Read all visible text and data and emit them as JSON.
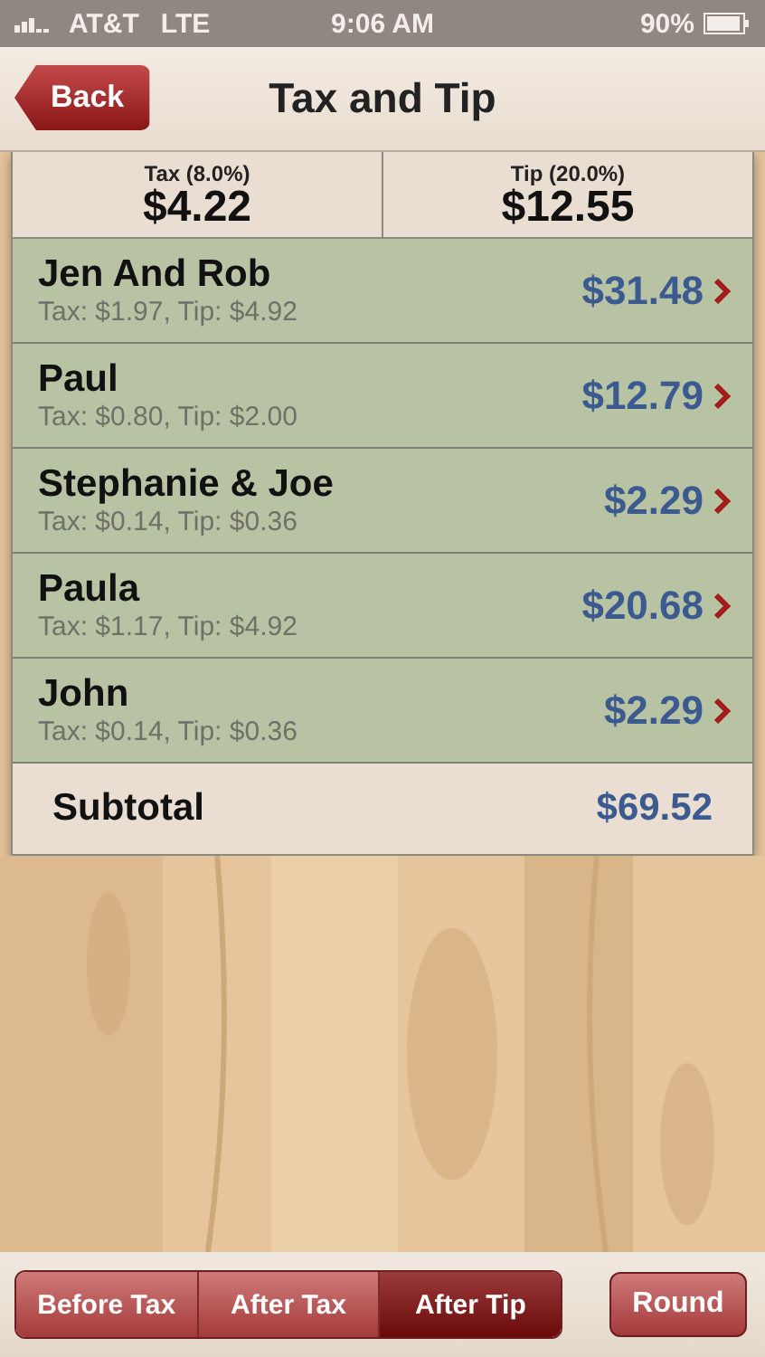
{
  "status_bar": {
    "carrier": "AT&T",
    "network": "LTE",
    "time": "9:06 AM",
    "battery": "90%"
  },
  "nav": {
    "back": "Back",
    "title": "Tax and Tip"
  },
  "summary": [
    {
      "label": "Tax (8.0%)",
      "amount": "$4.22"
    },
    {
      "label": "Tip (20.0%)",
      "amount": "$12.55"
    }
  ],
  "people": [
    {
      "name": "Jen And Rob",
      "detail": "Tax: $1.97, Tip: $4.92",
      "total": "$31.48"
    },
    {
      "name": "Paul",
      "detail": "Tax: $0.80, Tip: $2.00",
      "total": "$12.79"
    },
    {
      "name": "Stephanie & Joe",
      "detail": "Tax: $0.14, Tip: $0.36",
      "total": "$2.29"
    },
    {
      "name": "Paula",
      "detail": "Tax: $1.17, Tip: $4.92",
      "total": "$20.68"
    },
    {
      "name": "John",
      "detail": "Tax: $0.14, Tip: $0.36",
      "total": "$2.29"
    }
  ],
  "subtotal": {
    "label": "Subtotal",
    "amount": "$69.52"
  },
  "modes": [
    {
      "label": "Before Tax",
      "selected": false
    },
    {
      "label": "After Tax",
      "selected": false
    },
    {
      "label": "After Tip",
      "selected": true
    }
  ],
  "round_button": "Round"
}
